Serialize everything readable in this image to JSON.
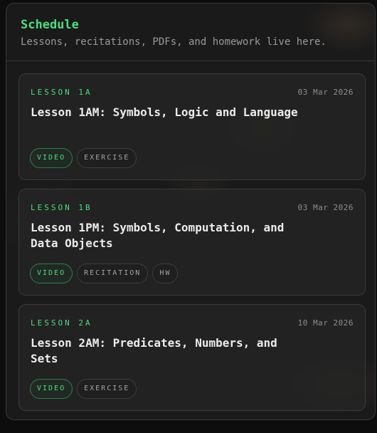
{
  "header": {
    "title": "Schedule",
    "subtitle": "Lessons, recitations, PDFs, and homework live here."
  },
  "lessons": [
    {
      "code": "LESSON 1A",
      "date": "03 Mar 2026",
      "title": "Lesson 1AM: Symbols, Logic and Language",
      "tags": [
        "VIDEO",
        "EXERCISE"
      ]
    },
    {
      "code": "LESSON 1B",
      "date": "03 Mar 2026",
      "title": "Lesson 1PM: Symbols, Computation, and Data Objects",
      "tags": [
        "VIDEO",
        "RECITATION",
        "HW"
      ]
    },
    {
      "code": "LESSON 2A",
      "date": "10 Mar 2026",
      "title": "Lesson 2AM: Predicates, Numbers, and Sets",
      "tags": [
        "VIDEO",
        "EXERCISE"
      ]
    }
  ],
  "colors": {
    "accent": "#4ade80",
    "background": "#1a1a1a"
  }
}
